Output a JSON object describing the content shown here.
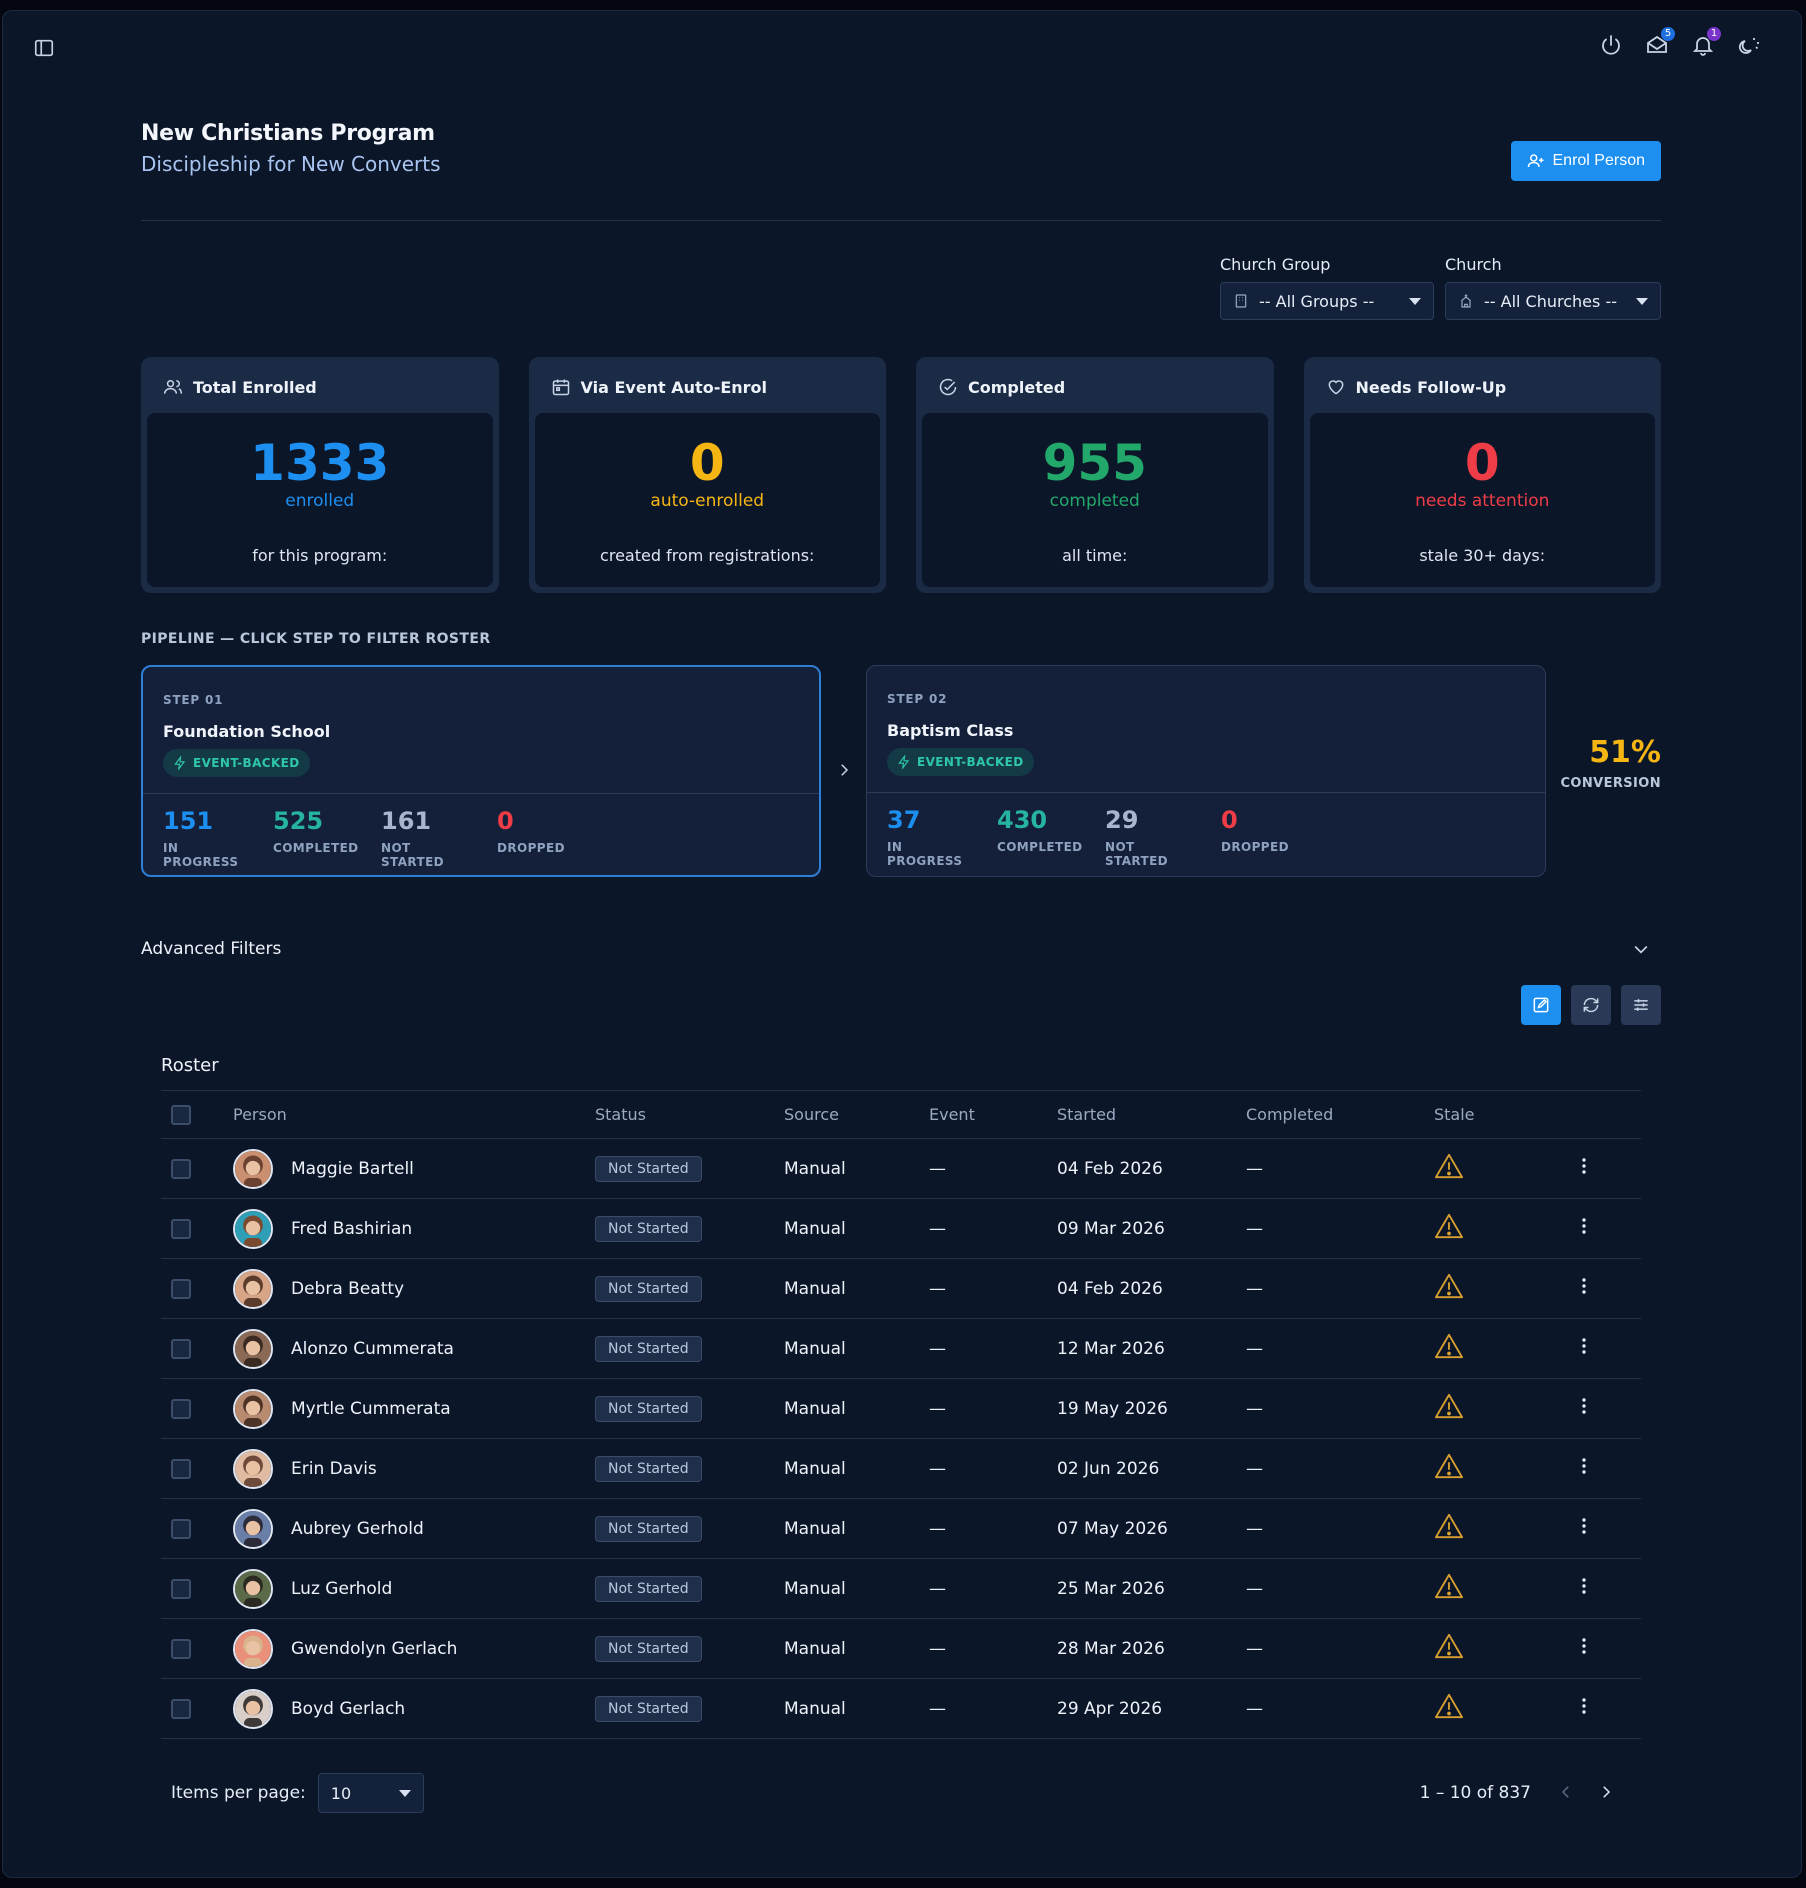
{
  "topbar": {
    "mail_badge": "5",
    "notif_badge": "1",
    "icons": [
      "sidebar-toggle-icon",
      "power-icon",
      "mail-icon",
      "bell-icon",
      "theme-icon"
    ]
  },
  "header": {
    "title": "New Christians Program",
    "subtitle": "Discipleship for New Converts",
    "enrol_label": "Enrol Person"
  },
  "filters": {
    "group_label": "Church Group",
    "group_value": "-- All Groups --",
    "church_label": "Church",
    "church_value": "-- All Churches --"
  },
  "stats": [
    {
      "title": "Total Enrolled",
      "value": "1333",
      "sub": "enrolled",
      "foot": "for this program:",
      "color": "#1d8ff0",
      "icon": "users-icon"
    },
    {
      "title": "Via Event Auto-Enrol",
      "value": "0",
      "sub": "auto-enrolled",
      "foot": "created from registrations:",
      "color": "#f5b613",
      "icon": "calendar-icon"
    },
    {
      "title": "Completed",
      "value": "955",
      "sub": "completed",
      "foot": "all time:",
      "color": "#22a86a",
      "icon": "check-circle-icon"
    },
    {
      "title": "Needs Follow-Up",
      "value": "0",
      "sub": "needs attention",
      "foot": "stale 30+ days:",
      "color": "#ef3d47",
      "icon": "heart-icon"
    }
  ],
  "pipeline": {
    "label": "PIPELINE — CLICK STEP TO FILTER ROSTER",
    "steps": [
      {
        "num": "STEP 01",
        "name": "Foundation School",
        "chip": "EVENT-BACKED",
        "in_progress": "151",
        "completed": "525",
        "not_started": "161",
        "dropped": "0"
      },
      {
        "num": "STEP 02",
        "name": "Baptism Class",
        "chip": "EVENT-BACKED",
        "in_progress": "37",
        "completed": "430",
        "not_started": "29",
        "dropped": "0"
      }
    ],
    "metric_labels": {
      "in_progress": "IN PROGRESS",
      "completed": "COMPLETED",
      "not_started": "NOT STARTED",
      "dropped": "DROPPED"
    },
    "conversion_value": "51%",
    "conversion_label": "CONVERSION"
  },
  "advanced_filters_label": "Advanced Filters",
  "roster": {
    "title": "Roster",
    "columns": [
      "Person",
      "Status",
      "Source",
      "Event",
      "Started",
      "Completed",
      "Stale"
    ],
    "rows": [
      {
        "name": "Maggie Bartell",
        "status": "Not Started",
        "source": "Manual",
        "event": "—",
        "started": "04 Feb 2026",
        "completed": "—"
      },
      {
        "name": "Fred Bashirian",
        "status": "Not Started",
        "source": "Manual",
        "event": "—",
        "started": "09 Mar 2026",
        "completed": "—"
      },
      {
        "name": "Debra Beatty",
        "status": "Not Started",
        "source": "Manual",
        "event": "—",
        "started": "04 Feb 2026",
        "completed": "—"
      },
      {
        "name": "Alonzo Cummerata",
        "status": "Not Started",
        "source": "Manual",
        "event": "—",
        "started": "12 Mar 2026",
        "completed": "—"
      },
      {
        "name": "Myrtle Cummerata",
        "status": "Not Started",
        "source": "Manual",
        "event": "—",
        "started": "19 May 2026",
        "completed": "—"
      },
      {
        "name": "Erin Davis",
        "status": "Not Started",
        "source": "Manual",
        "event": "—",
        "started": "02 Jun 2026",
        "completed": "—"
      },
      {
        "name": "Aubrey Gerhold",
        "status": "Not Started",
        "source": "Manual",
        "event": "—",
        "started": "07 May 2026",
        "completed": "—"
      },
      {
        "name": "Luz Gerhold",
        "status": "Not Started",
        "source": "Manual",
        "event": "—",
        "started": "25 Mar 2026",
        "completed": "—"
      },
      {
        "name": "Gwendolyn Gerlach",
        "status": "Not Started",
        "source": "Manual",
        "event": "—",
        "started": "28 Mar 2026",
        "completed": "—"
      },
      {
        "name": "Boyd Gerlach",
        "status": "Not Started",
        "source": "Manual",
        "event": "—",
        "started": "29 Apr 2026",
        "completed": "—"
      }
    ]
  },
  "pager": {
    "items_label": "Items per page:",
    "items_value": "10",
    "range": "1 – 10 of 837"
  },
  "colors": {
    "accent": "#1c8ff0",
    "in_progress": "#1d8ff0",
    "completed": "#26b3a0",
    "not_started": "#a7b6cc",
    "dropped": "#ef3d47",
    "warning": "#d8a030"
  }
}
